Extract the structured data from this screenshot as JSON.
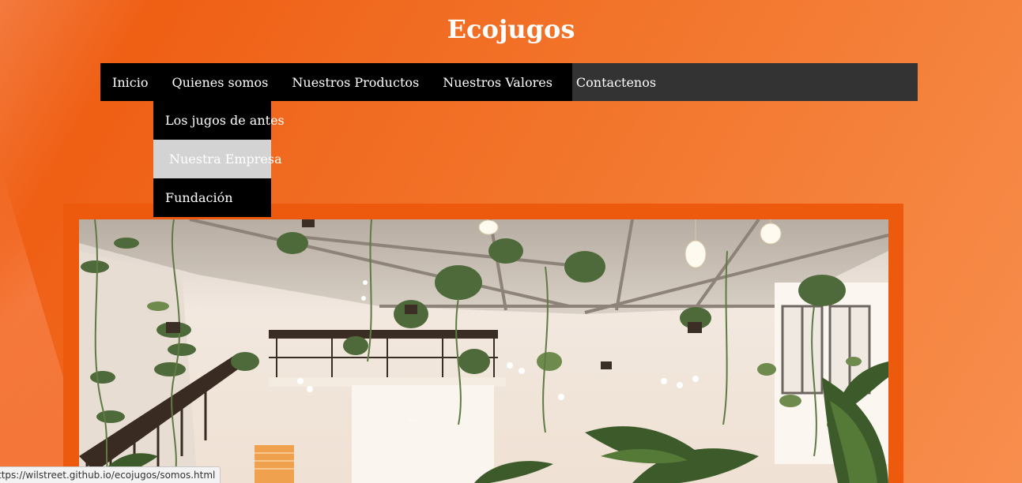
{
  "site": {
    "title": "Ecojugos"
  },
  "nav": {
    "items": [
      {
        "label": "Inicio"
      },
      {
        "label": "Quienes somos"
      },
      {
        "label": "Nuestros Productos"
      },
      {
        "label": "Nuestros Valores"
      },
      {
        "label": "Contactenos"
      }
    ]
  },
  "dropdown": {
    "items": [
      {
        "label": "Los jugos de antes"
      },
      {
        "label": "Nuestra Empresa"
      },
      {
        "label": "Fundación"
      }
    ]
  },
  "hero": {
    "image": "interior-plants-photo"
  },
  "status": {
    "url": "ttps://wilstreet.github.io/ecojugos/somos.html"
  },
  "colors": {
    "accent": "#ed5a0e",
    "navbar": "#333333",
    "nav_items": "#000000",
    "dropdown_hover": "#d3d3d3"
  }
}
